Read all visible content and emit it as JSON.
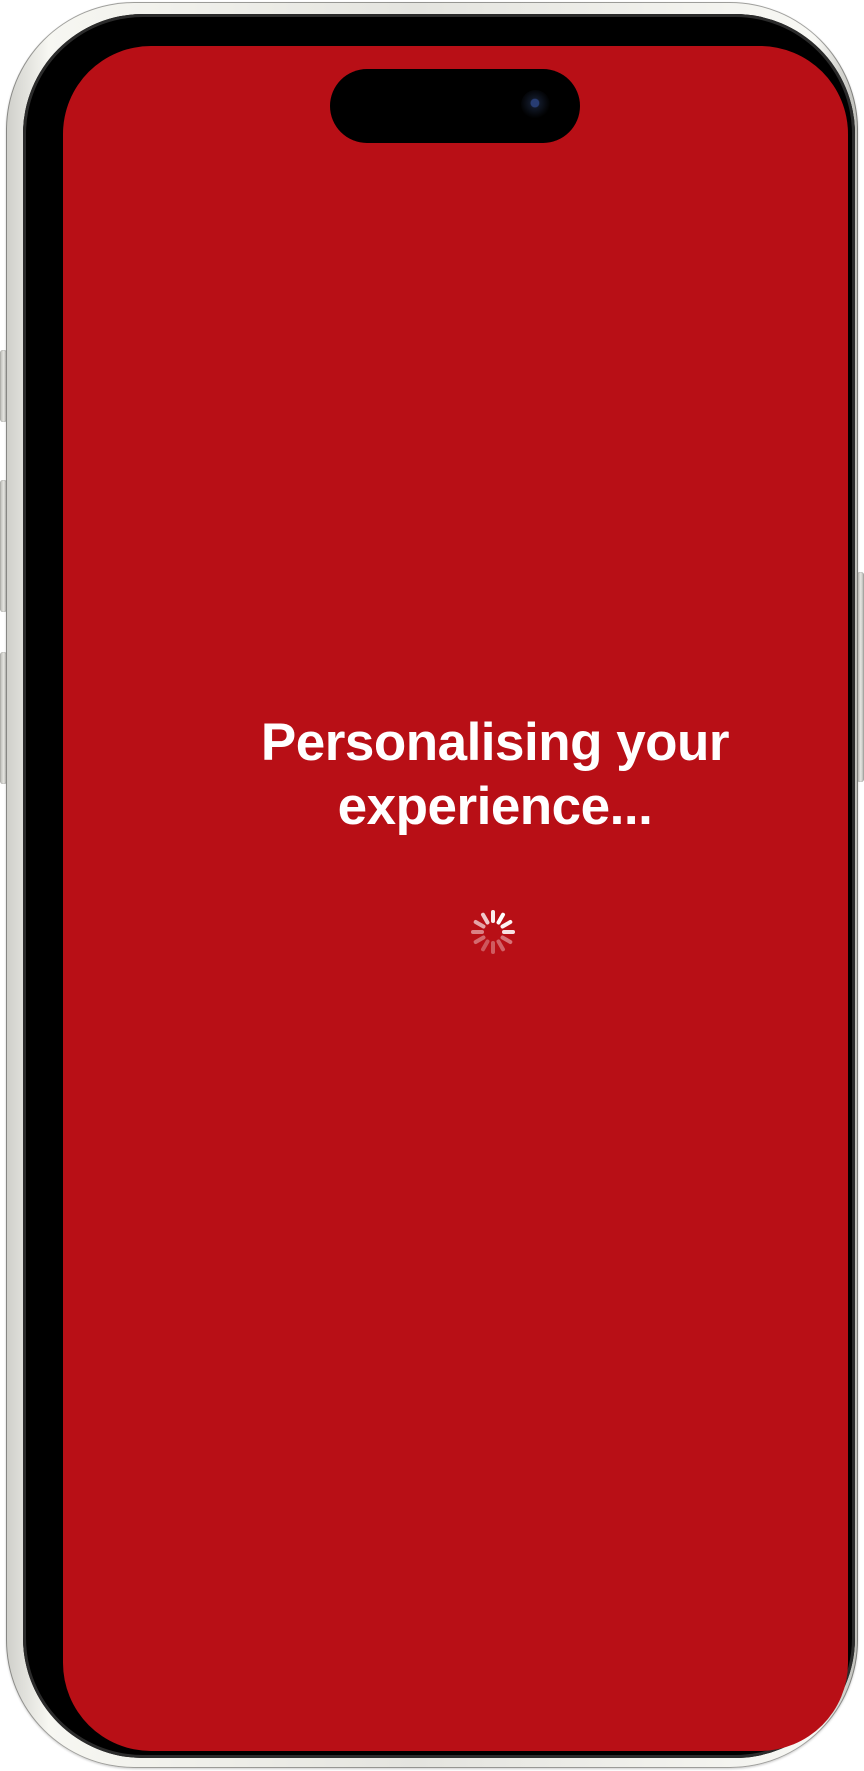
{
  "screen": {
    "background_color": "#b80f16",
    "text_color": "#ffffff"
  },
  "loading": {
    "title": "Personalising your experience...",
    "indicator": "loading-spinner-icon"
  }
}
